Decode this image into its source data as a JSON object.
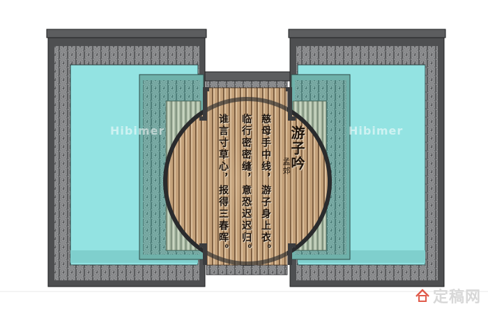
{
  "poem": {
    "title": "游子吟",
    "author": "孟郊",
    "lines": [
      "慈母手中线，游子身上衣。",
      "临行密密缝，意恐迟迟归。",
      "谁言寸草心，报得三春晖。"
    ]
  },
  "watermarks": [
    "Hibimer",
    "Hibimer"
  ],
  "brand": {
    "name": "定稿网",
    "logo_icon": "house-logo-icon"
  },
  "colors": {
    "wall_gray": "#4e4f51",
    "wall_dark": "#2a2b2d",
    "glass_cyan": "#93e3e2",
    "glass_teal": "#6fb1aa",
    "screen_green": "#a6b7a0",
    "wood_light": "#c8a57e",
    "wood_dark": "#8a6848"
  }
}
